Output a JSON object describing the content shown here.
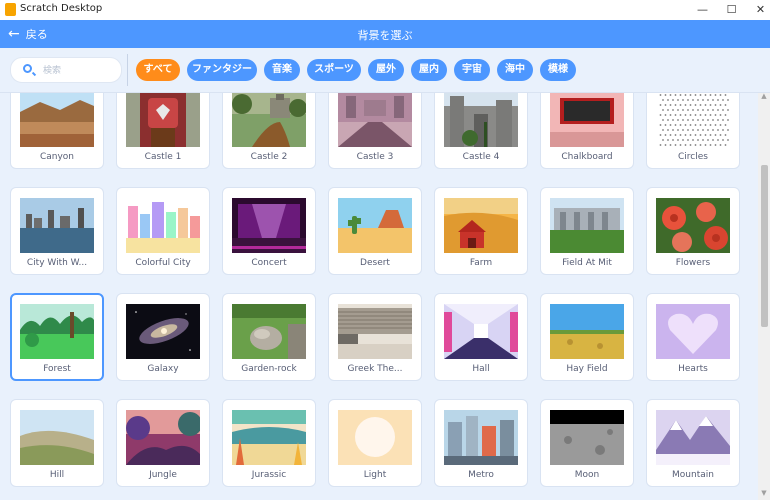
{
  "window": {
    "title": "Scratch Desktop",
    "min_glyph": "—",
    "max_glyph": "☐",
    "close_glyph": "✕"
  },
  "header": {
    "back_label": "戻る",
    "back_icon": "←",
    "title": "背景を選ぶ",
    "color": "#4d97ff"
  },
  "search": {
    "placeholder": "検索",
    "value": ""
  },
  "tags": [
    {
      "label": "すべて",
      "active": true
    },
    {
      "label": "ファンタジー",
      "active": false
    },
    {
      "label": "音楽",
      "active": false
    },
    {
      "label": "スポーツ",
      "active": false
    },
    {
      "label": "屋外",
      "active": false
    },
    {
      "label": "屋内",
      "active": false
    },
    {
      "label": "宇宙",
      "active": false
    },
    {
      "label": "海中",
      "active": false
    },
    {
      "label": "模様",
      "active": false
    }
  ],
  "backdrops": [
    {
      "name": "Canyon"
    },
    {
      "name": "Castle 1"
    },
    {
      "name": "Castle 2"
    },
    {
      "name": "Castle 3"
    },
    {
      "name": "Castle 4"
    },
    {
      "name": "Chalkboard"
    },
    {
      "name": "Circles"
    },
    {
      "name": "City With W..."
    },
    {
      "name": "Colorful City"
    },
    {
      "name": "Concert"
    },
    {
      "name": "Desert"
    },
    {
      "name": "Farm"
    },
    {
      "name": "Field At Mit"
    },
    {
      "name": "Flowers"
    },
    {
      "name": "Forest",
      "selected": true
    },
    {
      "name": "Galaxy"
    },
    {
      "name": "Garden-rock"
    },
    {
      "name": "Greek The..."
    },
    {
      "name": "Hall"
    },
    {
      "name": "Hay Field"
    },
    {
      "name": "Hearts"
    },
    {
      "name": "Hill"
    },
    {
      "name": "Jungle"
    },
    {
      "name": "Jurassic"
    },
    {
      "name": "Light"
    },
    {
      "name": "Metro"
    },
    {
      "name": "Moon"
    },
    {
      "name": "Mountain"
    }
  ]
}
